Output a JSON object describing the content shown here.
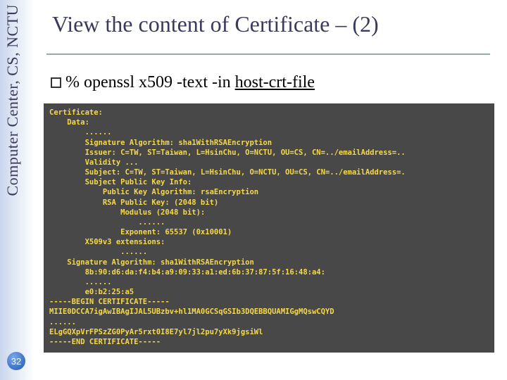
{
  "sidebar": {
    "label": "Computer Center, CS, NCTU",
    "page_number": "32"
  },
  "slide": {
    "title": "View the content of Certificate – (2)",
    "bullet_glyph": "❑",
    "command_prefix": "% ",
    "command_text": "openssl x509 -text -in ",
    "command_arg": "host-crt-file"
  },
  "code": {
    "l01": "Certificate:",
    "l02": "    Data:",
    "l03": "        ......",
    "l04": "        Signature Algorithm: sha1WithRSAEncryption",
    "l05": "        Issuer: C=TW, ST=Taiwan, L=HsinChu, O=NCTU, OU=CS, CN=../emailAddress=..",
    "l06": "        Validity ...",
    "l07": "        Subject: C=TW, ST=Taiwan, L=HsinChu, O=NCTU, OU=CS, CN=../emailAddress=.",
    "l08": "        Subject Public Key Info:",
    "l09": "            Public Key Algorithm: rsaEncryption",
    "l10": "            RSA Public Key: (2048 bit)",
    "l11": "                Modulus (2048 bit):",
    "l12": "                    ......",
    "l13": "                Exponent: 65537 (0x10001)",
    "l14": "        X509v3 extensions:",
    "l15": "                ......",
    "l16": "    Signature Algorithm: sha1WithRSAEncryption",
    "l17": "        8b:90:d6:da:f4:b4:a9:09:33:a1:ed:6b:37:87:5f:16:48:a4:",
    "l18": "        ......",
    "l19": "        e0:b2:25:a5",
    "l20": "-----BEGIN CERTIFICATE-----",
    "l21": "MIIE0DCCA7igAwIBAgIJAL5UBzbv+hl1MA0GCSqGSIb3DQEBBQUAMIGgMQswCQYD",
    "l22": "......",
    "l23": "ELgGQXpVrFPSzZG0PyAr5rxt0I8E7yl7jl2pu7yXk9jgsiWl",
    "l24": "-----END CERTIFICATE-----"
  }
}
